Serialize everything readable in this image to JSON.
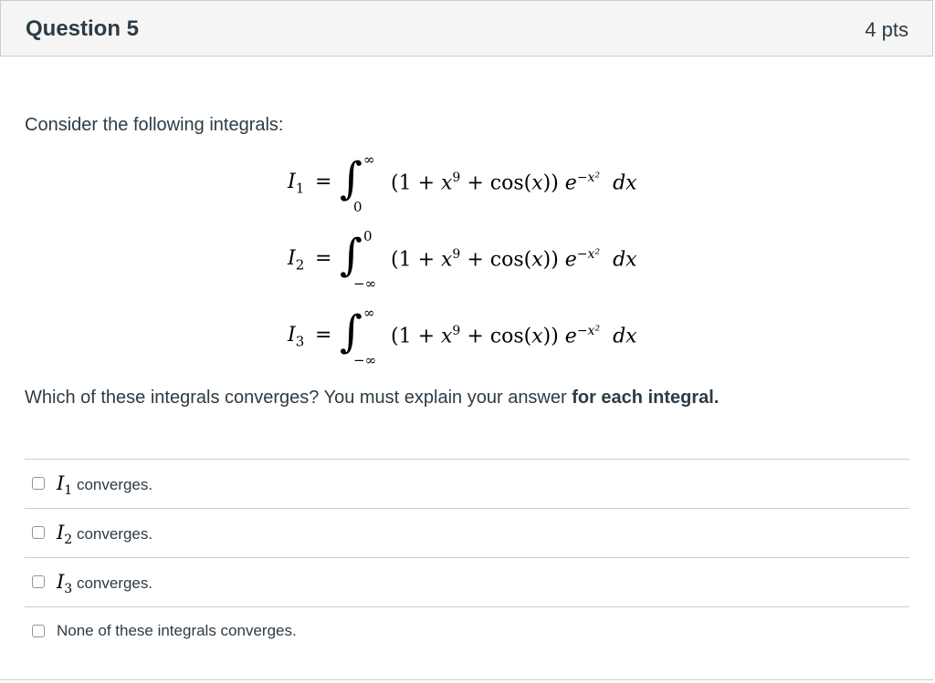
{
  "question": {
    "title": "Question 5",
    "points": "4 pts"
  },
  "prompt": {
    "intro": "Consider the following integrals:",
    "question_main": "Which of these integrals converges? You must explain your answer ",
    "question_bold": "for each integral."
  },
  "equations": [
    {
      "var": "I",
      "sub": "1",
      "upper": "∞",
      "lower": "0",
      "integrand_a": "(1 + ",
      "x": "x",
      "x_pow": "9",
      "integrand_b": " + cos(",
      "x2": "x",
      "integrand_c": ")) ",
      "e": "e",
      "e_pow": "−x²",
      "dx": "dx"
    },
    {
      "var": "I",
      "sub": "2",
      "upper": "0",
      "lower": "−∞",
      "integrand_a": "(1 + ",
      "x": "x",
      "x_pow": "9",
      "integrand_b": " + cos(",
      "x2": "x",
      "integrand_c": ")) ",
      "e": "e",
      "e_pow": "−x²",
      "dx": "dx"
    },
    {
      "var": "I",
      "sub": "3",
      "upper": "∞",
      "lower": "−∞",
      "integrand_a": "(1 + ",
      "x": "x",
      "x_pow": "9",
      "integrand_b": " + cos(",
      "x2": "x",
      "integrand_c": ")) ",
      "e": "e",
      "e_pow": "−x²",
      "dx": "dx"
    }
  ],
  "equals": "=",
  "integral_sign": "∫",
  "answers": [
    {
      "var": "I",
      "sub": "1",
      "label": " converges.",
      "checked": false
    },
    {
      "var": "I",
      "sub": "2",
      "label": " converges.",
      "checked": false
    },
    {
      "var": "I",
      "sub": "3",
      "label": " converges.",
      "checked": false
    },
    {
      "label": "None of these integrals converges.",
      "checked": false
    }
  ],
  "colors": {
    "header_bg": "#f5f5f5",
    "border": "#c7cdd1",
    "text": "#2d3b45"
  }
}
